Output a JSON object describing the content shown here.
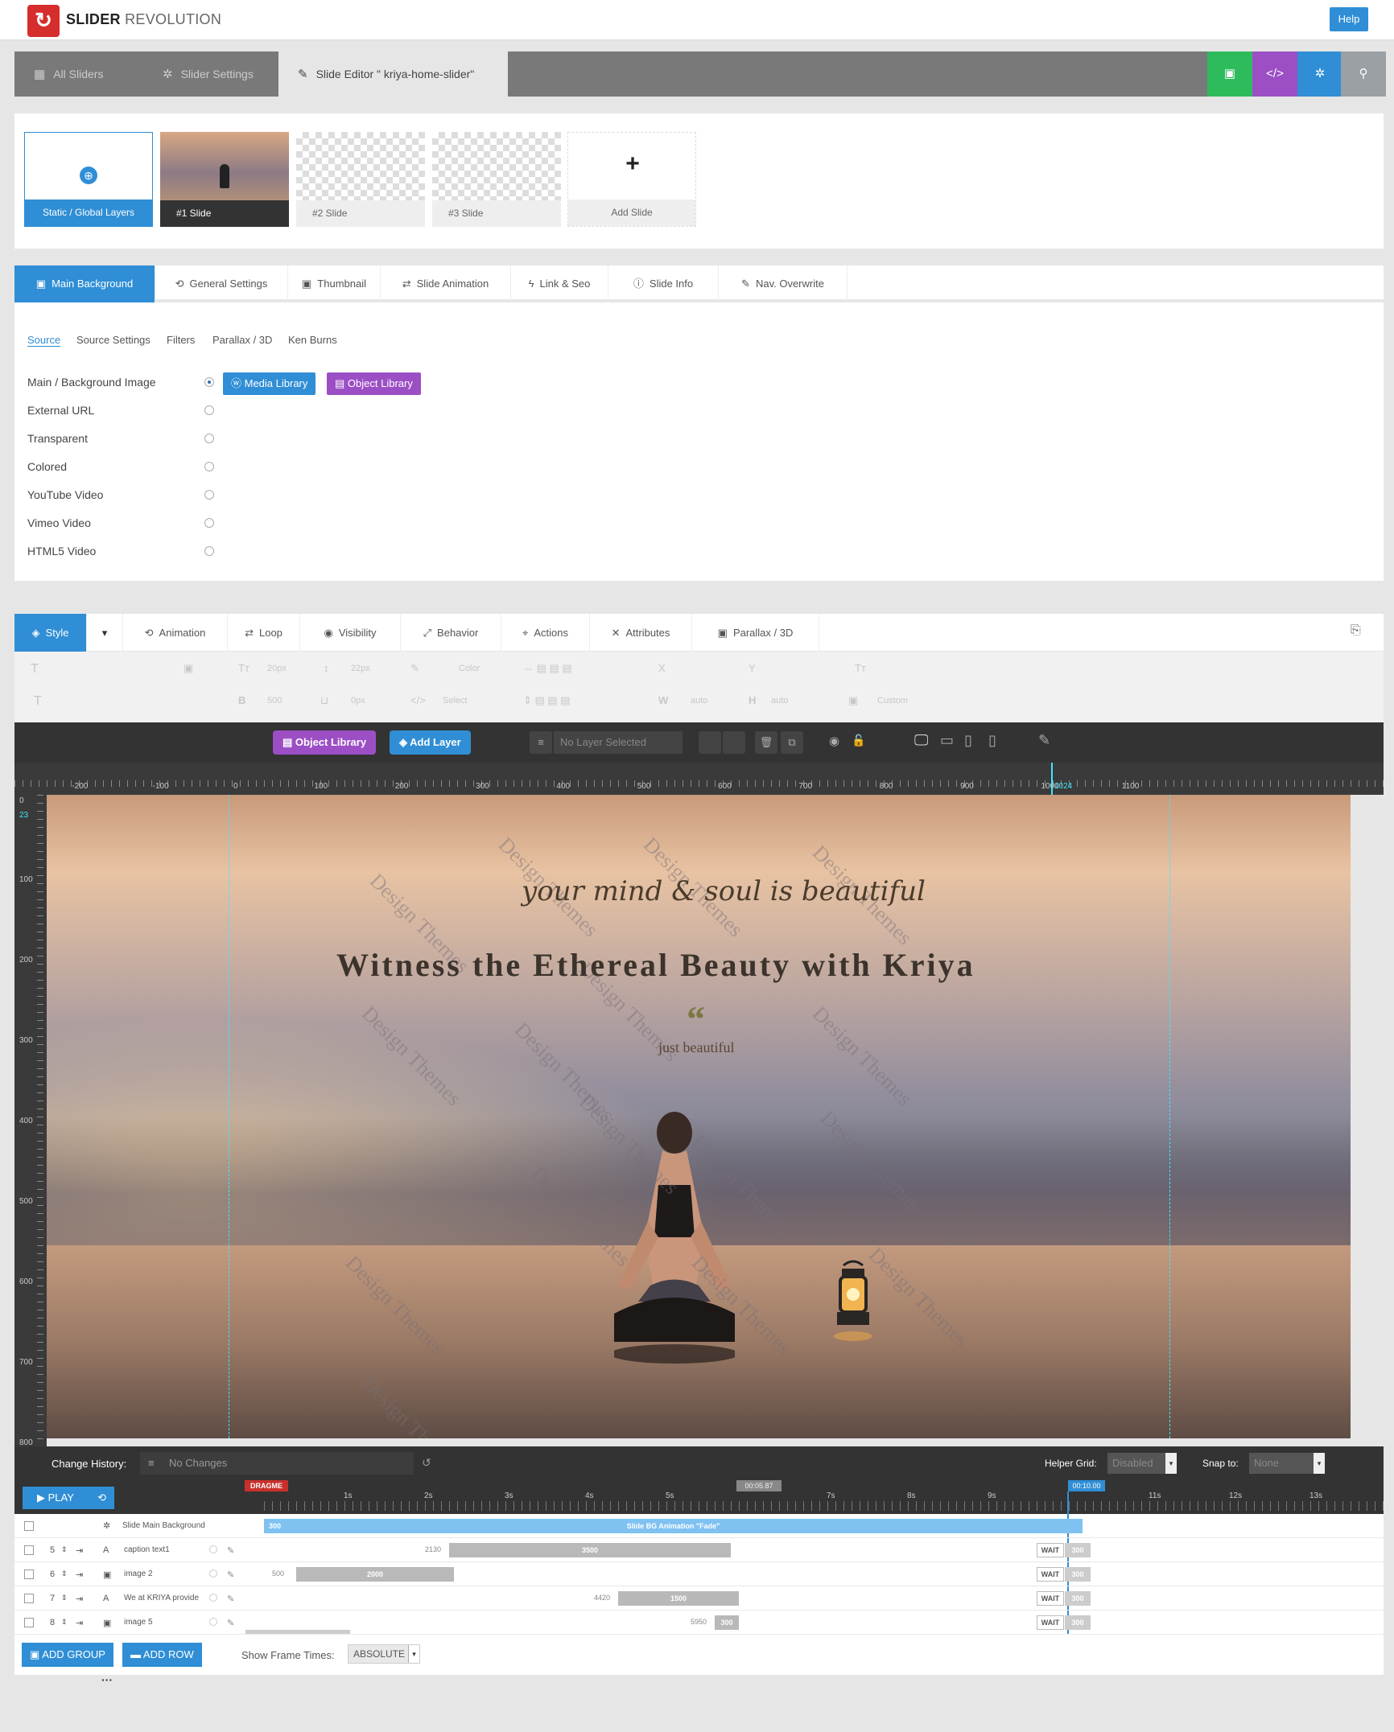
{
  "app": {
    "brand_bold": "SLIDER",
    "brand_thin": "REVOLUTION",
    "help": "Help"
  },
  "nav": {
    "tabs": [
      {
        "label": "All Sliders",
        "icon": "grid-icon"
      },
      {
        "label": "Slider Settings",
        "icon": "gear-icon"
      },
      {
        "label": "Slide Editor \" kriya-home-slider\"",
        "icon": "pencil-icon"
      }
    ],
    "actions": [
      {
        "name": "save-button",
        "icon": "save-icon",
        "glyph": "▣",
        "color": "#2ebb5c"
      },
      {
        "name": "embed-button",
        "icon": "code-icon",
        "glyph": "</>",
        "color": "#9c4fc5"
      },
      {
        "name": "settings-button",
        "icon": "gear-icon",
        "glyph": "✲",
        "color": "#2f8ed5"
      },
      {
        "name": "preview-button",
        "icon": "search-icon",
        "glyph": "⚲",
        "color": "#9aa0a4"
      }
    ]
  },
  "slides": [
    {
      "label": "Static / Global Layers"
    },
    {
      "label": "#1 Slide"
    },
    {
      "label": "#2 Slide"
    },
    {
      "label": "#3 Slide"
    },
    {
      "label": "Add Slide",
      "glyph": "+"
    }
  ],
  "bg_tabs": [
    {
      "label": "Main Background",
      "glyph": "▣"
    },
    {
      "label": "General Settings",
      "glyph": "⟲"
    },
    {
      "label": "Thumbnail",
      "glyph": "▣"
    },
    {
      "label": "Slide Animation",
      "glyph": "⇄"
    },
    {
      "label": "Link & Seo",
      "glyph": "ϟ"
    },
    {
      "label": "Slide Info",
      "glyph": "ⓘ"
    },
    {
      "label": "Nav. Overwrite",
      "glyph": "✎"
    }
  ],
  "source_subtabs": [
    "Source",
    "Source Settings",
    "Filters",
    "Parallax / 3D",
    "Ken Burns"
  ],
  "source_options": [
    "Main / Background Image",
    "External URL",
    "Transparent",
    "Colored",
    "YouTube Video",
    "Vimeo Video",
    "HTML5 Video"
  ],
  "source_selected": 0,
  "library_buttons": {
    "media": "Media Library",
    "object": "Object Library"
  },
  "layer_tabs": [
    {
      "label": "Style",
      "glyph": "◈"
    },
    {
      "label": "Animation",
      "glyph": "⟲"
    },
    {
      "label": "Loop",
      "glyph": "⇄"
    },
    {
      "label": "Visibility",
      "glyph": "◉"
    },
    {
      "label": "Behavior",
      "glyph": "⤢"
    },
    {
      "label": "Actions",
      "glyph": "⌖"
    },
    {
      "label": "Attributes",
      "glyph": "✕"
    },
    {
      "label": "Parallax / 3D",
      "glyph": "▣"
    }
  ],
  "style_fields": {
    "font_size": "20px",
    "line_height": "22px",
    "color": "Color",
    "font_weight": "500",
    "letter_spacing": "0px",
    "align": "Select",
    "x": "X",
    "y": "Y",
    "w": "auto",
    "h": "auto",
    "custom": "Custom"
  },
  "toolbar": {
    "object_library": "Object Library",
    "add_layer": "Add Layer",
    "no_layer": "No Layer Selected"
  },
  "ruler": {
    "h": [
      "-200",
      "-100",
      "0",
      "100",
      "200",
      "300",
      "400",
      "500",
      "600",
      "700",
      "800",
      "900",
      "1000",
      "1100"
    ],
    "h_marker": "1024",
    "v": [
      "0",
      "23",
      "100",
      "200",
      "300",
      "400",
      "500",
      "600",
      "700",
      "800"
    ]
  },
  "slide_text": {
    "script": "your mind & soul is beautiful",
    "headline": "Witness the Ethereal Beauty with Kriya",
    "quote": "“",
    "sub": "just beautiful",
    "watermark": "Design Themes"
  },
  "history": {
    "label": "Change History:",
    "value": "No Changes",
    "helper_label": "Helper Grid:",
    "helper_value": "Disabled",
    "snap_label": "Snap to:",
    "snap_value": "None"
  },
  "timeline": {
    "play": "PLAY",
    "dragme": "DRAGME",
    "ticks": [
      "1s",
      "2s",
      "3s",
      "4s",
      "5s",
      "7s",
      "8s",
      "9s",
      "11s",
      "12s",
      "13s"
    ],
    "cursor": "00:05.87",
    "end": "00:10.00",
    "bg_row": {
      "label": "Slide Main Background",
      "start": "300",
      "anim": "Slide BG Animation \"Fade\""
    },
    "rows": [
      {
        "z": "5",
        "type": "A",
        "name": "caption text1",
        "start": "2130",
        "dur": "3500"
      },
      {
        "z": "6",
        "type": "img",
        "name": "image 2",
        "start": "500",
        "dur": "2000"
      },
      {
        "z": "7",
        "type": "A",
        "name": "We at KRIYA provide",
        "start": "4420",
        "dur": "1500"
      },
      {
        "z": "8",
        "type": "img",
        "name": "image 5",
        "start": "5950",
        "dur": "300"
      }
    ],
    "wait": "WAIT",
    "end_val": "300"
  },
  "footer": {
    "add_group": "ADD GROUP",
    "add_row": "ADD ROW",
    "frame_label": "Show Frame Times:",
    "frame_value": "ABSOLUTE"
  }
}
